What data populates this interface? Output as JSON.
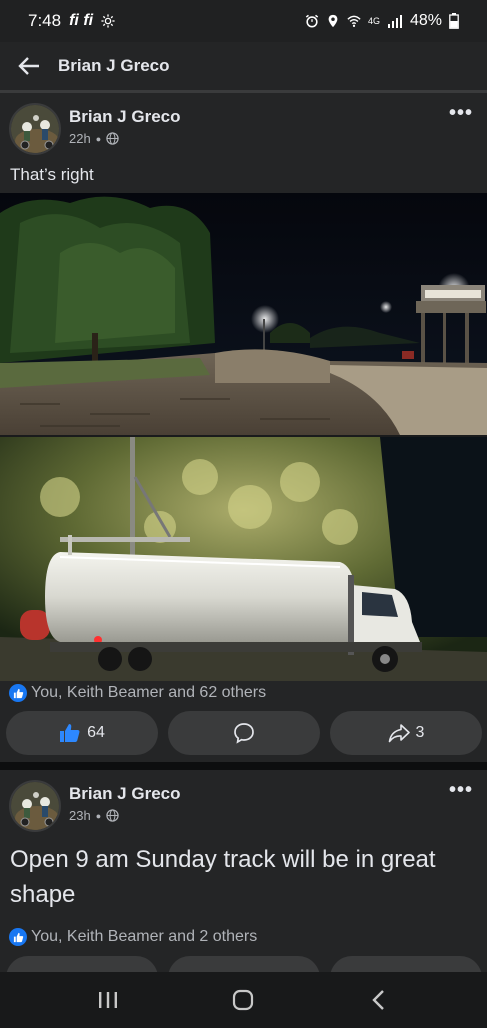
{
  "status_bar": {
    "time": "7:48",
    "carrier_icons": "fi fi",
    "network": "4G",
    "battery": "48%"
  },
  "header": {
    "title": "Brian J Greco"
  },
  "posts": [
    {
      "author": "Brian J Greco",
      "time": "22h",
      "text": "That’s right",
      "reactions": "You, Keith Beamer and 62 others",
      "likes": "64",
      "shares": "3"
    },
    {
      "author": "Brian J Greco",
      "time": "23h",
      "text": "Open 9 am Sunday track will be in great shape",
      "reactions": "You, Keith Beamer and 2 others"
    }
  ],
  "colors": {
    "accent": "#1877f2",
    "background": "#18191a",
    "card": "#242526",
    "button": "#3a3b3c"
  }
}
